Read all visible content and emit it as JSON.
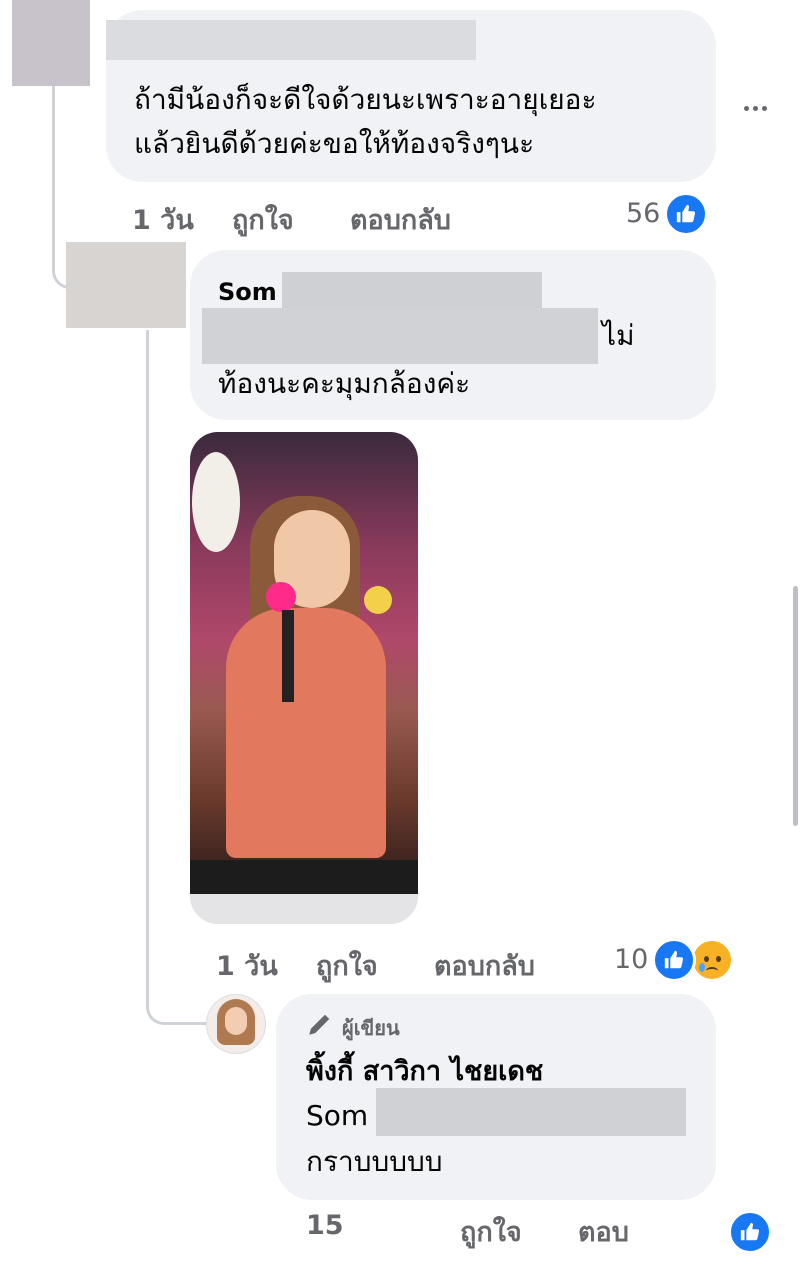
{
  "comment1": {
    "text_line1": "ถ้ามีน้องก็จะดีใจด้วยนะเพราะอายุเยอะ",
    "text_line2": "แล้วยินดีด้วยค่ะขอให้ท้องจริงๆนะ",
    "time": "1 วัน",
    "like_label": "ถูกใจ",
    "reply_label": "ตอบกลับ",
    "reaction_count": "56"
  },
  "reply1": {
    "author": "Som",
    "text_suffix": "ไม่",
    "text_line3": "ท้องนะคะมุมกล้องค่ะ",
    "time": "1 วัน",
    "like_label": "ถูกใจ",
    "reply_label": "ตอบกลับ",
    "reaction_count": "10"
  },
  "reply2": {
    "badge": "ผู้เขียน",
    "author": "พิ้งกี้ สาวิกา ไชยเดช",
    "mention": "Som",
    "text": "กราบบบบบ",
    "time": "15",
    "like_label": "ถูกใจ",
    "reply_label": "ตอบ"
  },
  "colors": {
    "accent": "#1877f2",
    "bubble": "#f0f2f5",
    "meta": "#65676b"
  }
}
